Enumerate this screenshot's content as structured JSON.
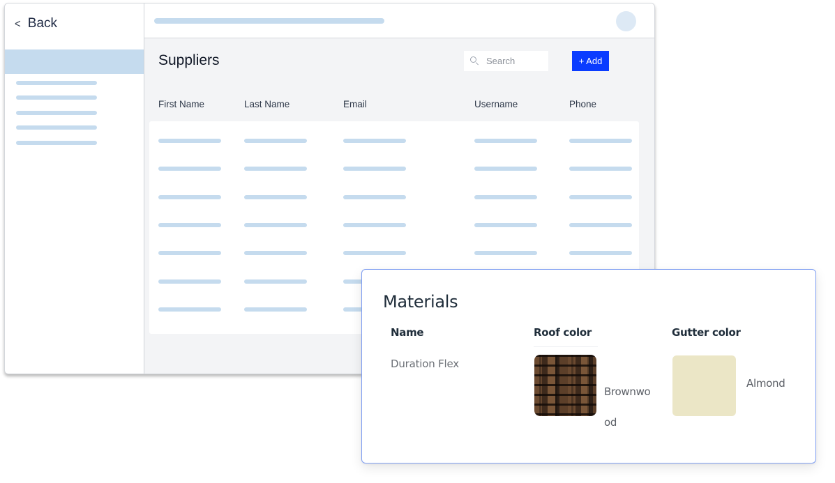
{
  "sidebar": {
    "back_label": "Back",
    "back_icon": "chevron-left-icon",
    "back_glyph": "<",
    "placeholder_items": 5
  },
  "topbar": {
    "avatar": "avatar"
  },
  "suppliers": {
    "title": "Suppliers",
    "search": {
      "placeholder": "Search",
      "icon": "search-icon"
    },
    "add_button_label": "+ Add",
    "columns": [
      "First Name",
      "Last Name",
      "Email",
      "Username",
      "Phone"
    ],
    "placeholder_rows": 7
  },
  "materials": {
    "title": "Materials",
    "columns": [
      "Name",
      "Roof color",
      "Gutter color"
    ],
    "rows": [
      {
        "name": "Duration Flex",
        "roof_color": "Brownwood",
        "gutter_color": "Almond"
      }
    ]
  },
  "colors": {
    "accent": "#0a3cff",
    "skeleton": "#c5dbee",
    "card_border": "#7f9ef2",
    "almond": "#ebe6c6",
    "brownwood": "#4a3322"
  }
}
